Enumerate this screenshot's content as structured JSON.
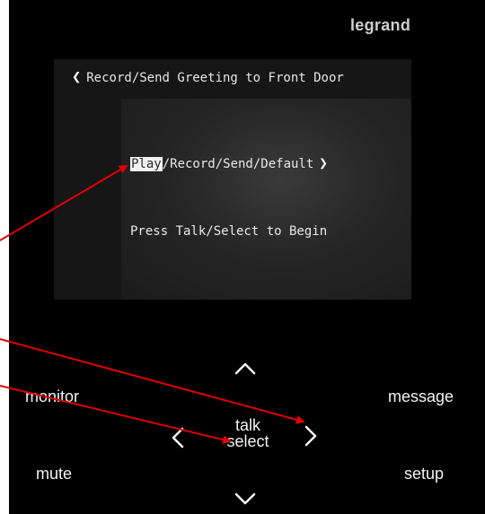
{
  "brand": "legrand",
  "screen": {
    "title": "Record/Send Greeting to Front Door",
    "menu": {
      "highlighted": "Play",
      "rest": "/Record/Send/Default"
    },
    "hint": "Press Talk/Select to Begin"
  },
  "buttons": {
    "monitor": "monitor",
    "message": "message",
    "mute": "mute",
    "setup": "setup",
    "talk": "talk",
    "select": "select"
  },
  "colors": {
    "panel": "#000000",
    "annotation": "#e00000"
  }
}
